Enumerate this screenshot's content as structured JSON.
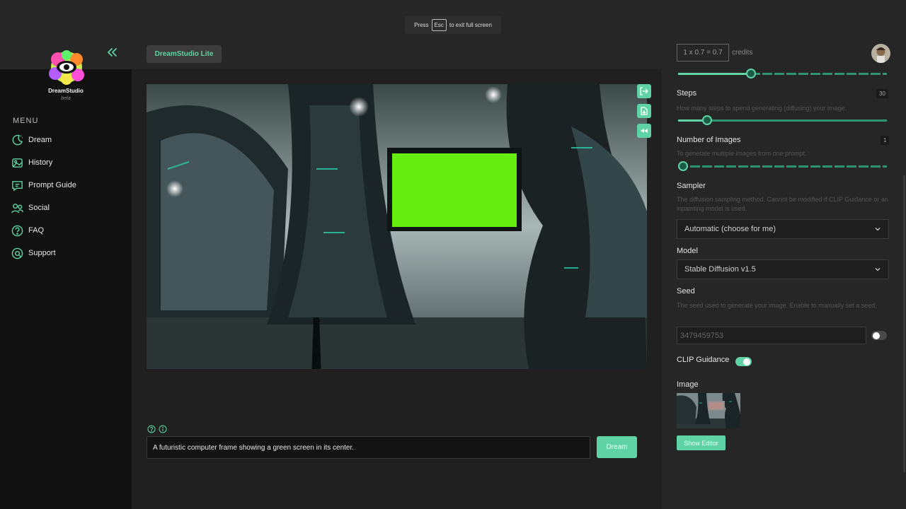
{
  "fullscreen_toast": {
    "press": "Press",
    "key": "Esc",
    "suffix": "to exit full screen"
  },
  "brand": {
    "name": "DreamStudio",
    "sub": "beta"
  },
  "menu": {
    "label": "MENU",
    "items": [
      {
        "label": "Dream",
        "icon": "dream-icon"
      },
      {
        "label": "History",
        "icon": "history-icon"
      },
      {
        "label": "Prompt Guide",
        "icon": "prompt-guide-icon"
      },
      {
        "label": "Social",
        "icon": "social-icon"
      },
      {
        "label": "FAQ",
        "icon": "faq-icon"
      },
      {
        "label": "Support",
        "icon": "support-icon"
      }
    ]
  },
  "header": {
    "chip_label": "DreamStudio Lite"
  },
  "credits": {
    "formula": "1 x 0.7 = 0.7",
    "label": "credits"
  },
  "settings": {
    "cfg_slider_fraction": 0.35,
    "steps": {
      "label": "Steps",
      "value": "30",
      "description": "How many steps to spend generating (diffusing) your image.",
      "slider_fraction": 0.14
    },
    "num_images": {
      "label": "Number of Images",
      "value": "1",
      "description": "To generate multiple images from one prompt.",
      "slider_fraction": 0.0
    },
    "sampler": {
      "label": "Sampler",
      "description": "The diffusion sampling method. Cannot be modified if CLIP Guidance or an inpainting model is used.",
      "selected": "Automatic (choose for me)"
    },
    "model": {
      "label": "Model",
      "selected": "Stable Diffusion v1.5"
    },
    "seed": {
      "label": "Seed",
      "description": "The seed used to generate your image. Enable to manually set a seed.",
      "placeholder": "3479459753",
      "enabled": false
    },
    "clip_guidance": {
      "label": "CLIP Guidance",
      "enabled": true
    },
    "image": {
      "label": "Image",
      "button": "Show Editor"
    }
  },
  "prompt": {
    "text": "A futuristic computer frame showing a green screen in its center.",
    "submit": "Dream"
  },
  "colors": {
    "accent": "#5fd3a5",
    "sidebar_bg": "#111111",
    "panel_bg": "#262626",
    "green_screen": "#66ee11"
  }
}
